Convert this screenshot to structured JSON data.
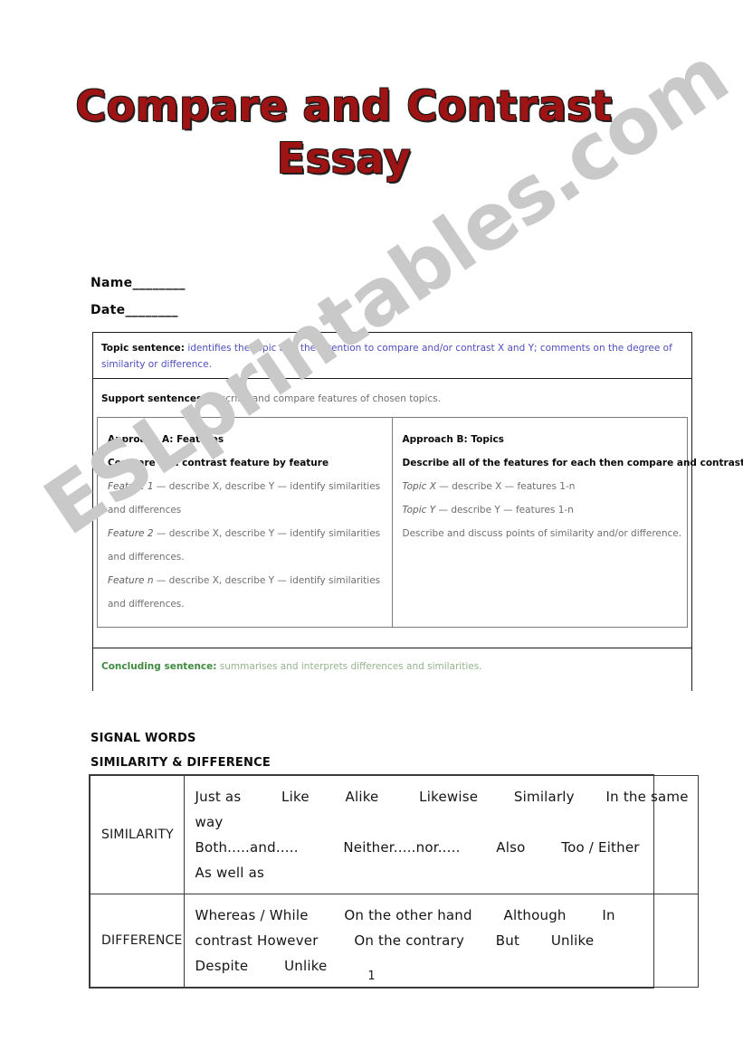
{
  "document": {
    "title_line1": "Compare and Contrast",
    "title_line2": "Essay",
    "page_number": "1",
    "watermark": "ESLprintables.com",
    "title_color": "#9e1313",
    "accent_blue": "#4d4dbf",
    "accent_green": "#3f8a3f"
  },
  "fields": {
    "name": "Name________",
    "date": "Date________"
  },
  "structure": {
    "topic": {
      "label": "Topic sentence:",
      "text": " identifies the topic and the intention to compare and/or contrast X and Y; comments on the degree of similarity or difference."
    },
    "support": {
      "label": "Support sentences:",
      "text": " describe and compare features of chosen topics."
    },
    "concluding": {
      "label": "Concluding sentence:",
      "text": " summarises and interprets differences and similarities."
    },
    "approach_a": {
      "heading": "Approach A: Features",
      "subheading": "Compare and contrast feature by feature",
      "lines": [
        {
          "italic": "Feature 1",
          "rest": " — describe X, describe Y — identify similarities and differences"
        },
        {
          "italic": "Feature 2",
          "rest": " — describe X, describe Y — identify similarities and differences."
        },
        {
          "italic": "Feature n",
          "rest": " — describe X, describe Y — identify similarities and differences."
        }
      ]
    },
    "approach_b": {
      "heading": "Approach B: Topics",
      "subheading": "Describe all of the features for each then compare and contrast",
      "lines": [
        {
          "italic": "Topic X",
          "rest": " — describe X — features 1-n"
        },
        {
          "italic": "Topic Y",
          "rest": " — describe Y — features 1-n"
        },
        {
          "italic": "",
          "rest": "Describe and discuss points of similarity and/or difference."
        }
      ]
    }
  },
  "signal_words": {
    "heading1": "SIGNAL WORDS",
    "heading2": "SIMILARITY & DIFFERENCE",
    "rows": [
      {
        "category": "SIMILARITY",
        "lines": [
          "Just as         Like        Alike         Likewise        Similarly       In the same",
          "way",
          "Both.....and.....          Neither.....nor.....        Also        Too / Either",
          "As well as"
        ]
      },
      {
        "category": "DIFFERENCE",
        "lines": [
          "Whereas / While        On the other hand       Although        In",
          "contrast However        On the contrary       But       Unlike",
          "Despite        Unlike"
        ]
      }
    ]
  }
}
